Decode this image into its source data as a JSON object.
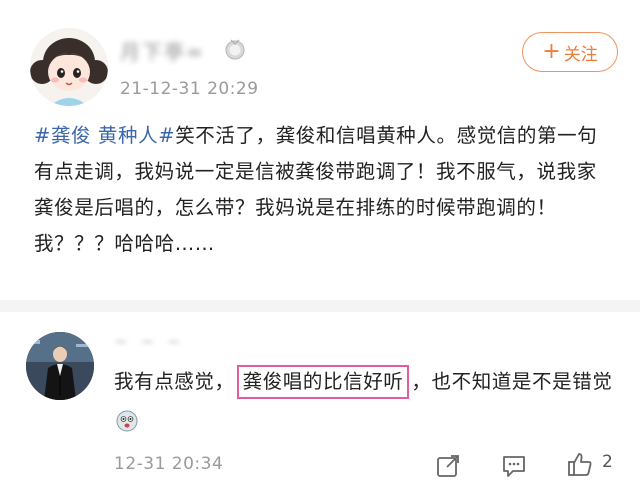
{
  "post": {
    "username": "月下亭=",
    "timestamp": "21-12-31 20:29",
    "follow_label": "关注",
    "follow_plus": "+",
    "hashtag": "#龚俊 黄种人#",
    "body_text": "笑不活了，龚俊和信唱黄种人。感觉信的第一句有点走调，我妈说一定是信被龚俊带跑调了！我不服气，说我家龚俊是后唱的，怎么带？我妈说是在排练的时候带跑调的！我？？？哈哈哈……"
  },
  "comment": {
    "username": "~ ~ ~",
    "text_before": "我有点感觉，",
    "text_highlight": "龚俊唱的比信好听",
    "text_after": "，也不知道是不是错觉",
    "timestamp": "12-31 20:34",
    "like_count": "2"
  },
  "icons": {
    "badge": "medal-badge-icon",
    "share": "share-icon",
    "reply": "comment-icon",
    "like": "thumbs-up-icon",
    "emoji": "surprised-face-emoji-icon"
  },
  "colors": {
    "hashtag": "#3b67a8",
    "follow": "#ee7d3c",
    "highlight_border": "#e35d9c",
    "meta_text": "#9a9a9a"
  }
}
